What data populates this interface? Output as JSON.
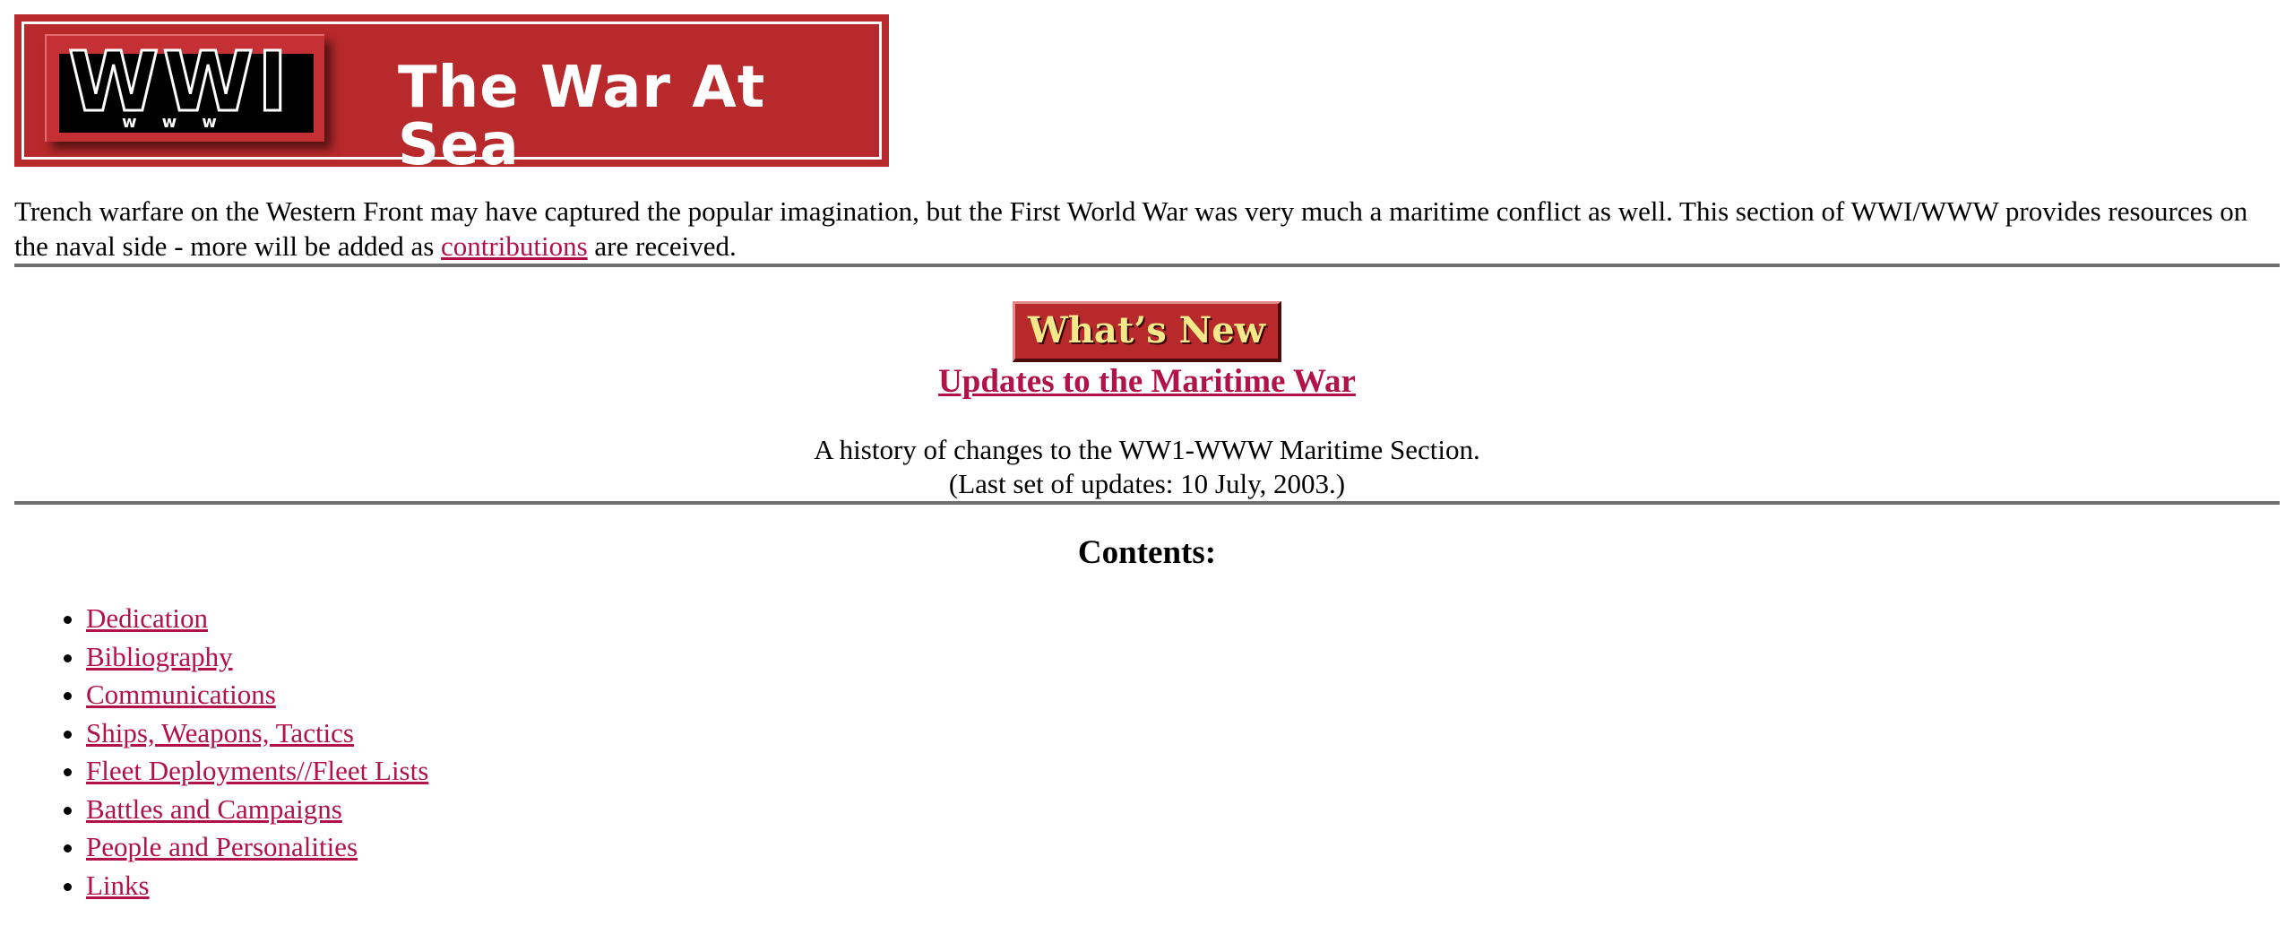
{
  "banner": {
    "logo_text": "WWI",
    "logo_subtext": "www",
    "title": "The War At Sea"
  },
  "intro": {
    "text_before_link": "Trench warfare on the Western Front may have captured the popular imagination, but the First World War was very much a maritime conflict as well. This section of WWI/WWW provides resources on the naval side - more will be added as ",
    "link_label": "contributions",
    "text_after_link": " are received."
  },
  "whats_new": {
    "button_label": "What’s New",
    "heading_link": "Updates to the Maritime War",
    "description_line1": "A history of changes to the WW1-WWW Maritime Section.",
    "description_line2": "(Last set of updates: 10 July, 2003.)"
  },
  "contents": {
    "heading": "Contents:",
    "items": [
      {
        "label": "Dedication"
      },
      {
        "label": "Bibliography"
      },
      {
        "label": "Communications"
      },
      {
        "label": "Ships, Weapons, Tactics"
      },
      {
        "label": "Fleet Deployments//Fleet Lists"
      },
      {
        "label": "Battles and Campaigns"
      },
      {
        "label": "People and Personalities"
      },
      {
        "label": "Links"
      }
    ]
  },
  "colors": {
    "link": "#b1124a",
    "banner_red": "#b8292b",
    "button_text": "#f3e98a",
    "rule": "#6f6f6f"
  }
}
